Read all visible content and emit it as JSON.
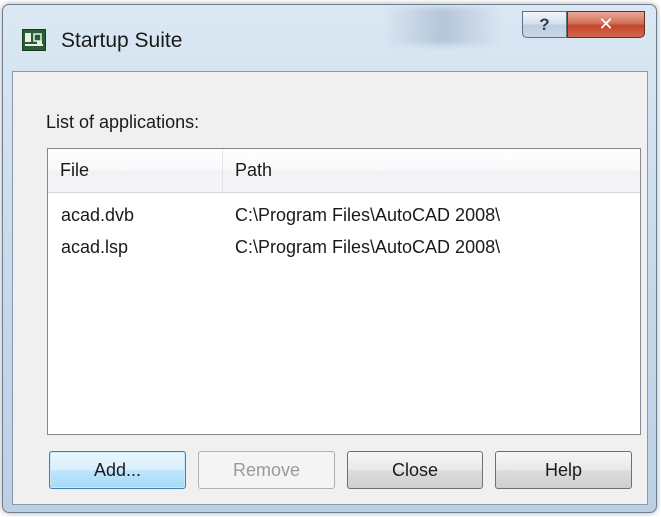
{
  "window": {
    "title": "Startup Suite",
    "help_glyph": "?",
    "close_glyph": "✕"
  },
  "caption": "List of applications:",
  "table": {
    "columns": [
      "File",
      "Path"
    ],
    "rows": [
      {
        "file": "acad.dvb",
        "path": "C:\\Program Files\\AutoCAD 2008\\"
      },
      {
        "file": "acad.lsp",
        "path": "C:\\Program Files\\AutoCAD 2008\\"
      }
    ]
  },
  "buttons": {
    "add": "Add...",
    "remove": "Remove",
    "close": "Close",
    "help": "Help"
  },
  "icons": {
    "app": "autocad-app-icon",
    "help": "question-mark-icon",
    "close": "close-x-icon"
  },
  "colors": {
    "close_button": "#c3462c",
    "default_button_border": "#3c7fb1",
    "disabled_text": "#9a9a9a"
  }
}
